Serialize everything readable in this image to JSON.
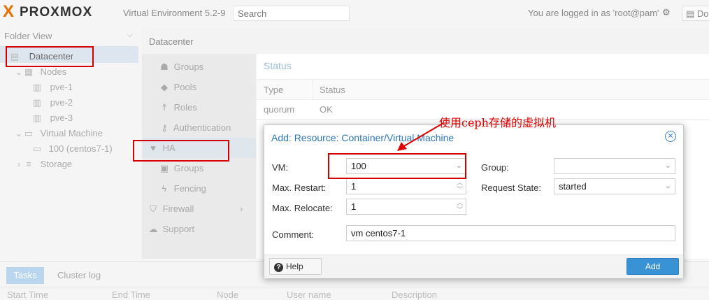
{
  "header": {
    "logo_mark": "X",
    "logo_text": "PROXMOX",
    "version": "Virtual Environment 5.2-9",
    "search_placeholder": "Search",
    "logged_in": "You are logged in as 'root@pam'",
    "docs_label": "Doc",
    "icons": {
      "gear": "gear-icon",
      "docs": "book-icon"
    }
  },
  "tree": {
    "view_label": "Folder View",
    "items": [
      {
        "label": "Datacenter",
        "icon": "datacenter-icon"
      },
      {
        "label": "Nodes",
        "icon": "building-icon"
      },
      {
        "label": "pve-1",
        "icon": "server-ok-icon"
      },
      {
        "label": "pve-2",
        "icon": "server-ok-icon"
      },
      {
        "label": "pve-3",
        "icon": "server-ok-icon"
      },
      {
        "label": "Virtual Machine",
        "icon": "monitor-icon"
      },
      {
        "label": "100 (centos7-1)",
        "icon": "vm-running-icon"
      },
      {
        "label": "Storage",
        "icon": "database-icon"
      }
    ]
  },
  "content": {
    "breadcrumb": "Datacenter",
    "nav": [
      {
        "label": "Groups",
        "icon": "users-icon"
      },
      {
        "label": "Pools",
        "icon": "tags-icon"
      },
      {
        "label": "Roles",
        "icon": "male-icon"
      },
      {
        "label": "Authentication",
        "icon": "key-icon"
      },
      {
        "label": "HA",
        "icon": "heartbeat-icon"
      },
      {
        "label": "Groups",
        "icon": "object-group-icon"
      },
      {
        "label": "Fencing",
        "icon": "bolt-icon"
      },
      {
        "label": "Firewall",
        "icon": "shield-icon"
      },
      {
        "label": "Support",
        "icon": "comments-icon"
      }
    ],
    "status": {
      "title": "Status",
      "columns": [
        "Type",
        "Status"
      ],
      "rows": [
        [
          "quorum",
          "OK"
        ]
      ]
    }
  },
  "bottom": {
    "tabs": [
      "Tasks",
      "Cluster log"
    ],
    "columns": [
      "Start Time",
      "End Time",
      "Node",
      "User name",
      "Description"
    ]
  },
  "dialog": {
    "title": "Add: Resource: Container/Virtual Machine",
    "vm_label": "VM:",
    "vm_value": "100",
    "max_restart_label": "Max. Restart:",
    "max_restart_value": "1",
    "max_relocate_label": "Max. Relocate:",
    "max_relocate_value": "1",
    "group_label": "Group:",
    "group_value": "",
    "request_state_label": "Request State:",
    "request_state_value": "started",
    "comment_label": "Comment:",
    "comment_value": "vm centos7-1",
    "help_label": "Help",
    "add_label": "Add"
  },
  "annotation": {
    "text": "使用ceph存储的虚拟机",
    "color": "#e00000"
  }
}
